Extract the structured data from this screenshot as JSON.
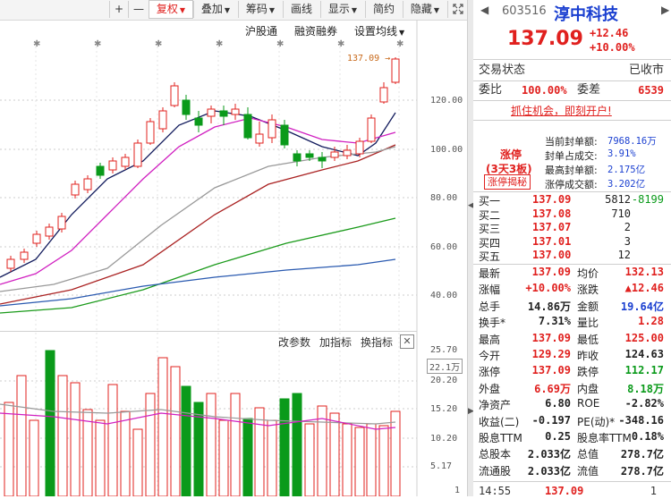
{
  "toolbar": {
    "plus": "+",
    "minus": "—",
    "fuquan": "复权",
    "diejia": "叠加",
    "choumai": "筹码",
    "huaxian": "画线",
    "xianshi": "显示",
    "jianyue": "简约",
    "yincang": "隐藏",
    "icon": "expand-icon"
  },
  "subbar": {
    "hugutong": "沪股通",
    "rongzi": "融资融券",
    "shezhi": "设置均线"
  },
  "price_axis": {
    "ticks": [
      "120.00",
      "100.00",
      "80.00",
      "60.00",
      "40.00"
    ],
    "last_label": "137.09"
  },
  "volume_panel": {
    "buttons": [
      "改参数",
      "加指标",
      "换指标"
    ],
    "ticks": [
      "25.70",
      "22.1万",
      "20.20",
      "15.20",
      "10.20",
      "5.17",
      "1"
    ]
  },
  "quote": {
    "code": "603516",
    "name": "淳中科技",
    "price": "137.09",
    "change": "+12.46",
    "change_pct": "+10.00%",
    "status_label": "交易状态",
    "status_value": "已收市",
    "weibi_label": "委比",
    "weibi_value": "100.00%",
    "weicha_label": "委差",
    "weicha_value": "6539",
    "ad": "抓住机会，即刻开户!"
  },
  "limit": {
    "tag": "涨停",
    "days": "(3天3板)",
    "button": "涨停揭秘",
    "rows": [
      {
        "label": "当前封单额:",
        "value": "7968.16万"
      },
      {
        "label": "封单占成交:",
        "value": "3.91%"
      },
      {
        "label": "最高封单额:",
        "value": "2.175亿"
      },
      {
        "label": "涨停成交额:",
        "value": "3.202亿"
      }
    ]
  },
  "orderbook": [
    {
      "label": "买一",
      "price": "137.09",
      "vol": "5812",
      "chg": "-8199"
    },
    {
      "label": "买二",
      "price": "137.08",
      "vol": "710",
      "chg": ""
    },
    {
      "label": "买三",
      "price": "137.07",
      "vol": "2",
      "chg": ""
    },
    {
      "label": "买四",
      "price": "137.01",
      "vol": "3",
      "chg": ""
    },
    {
      "label": "买五",
      "price": "137.00",
      "vol": "12",
      "chg": ""
    }
  ],
  "stats": [
    {
      "l1": "最新",
      "v1": "137.09",
      "c1": "red",
      "l2": "均价",
      "v2": "132.13",
      "c2": "red"
    },
    {
      "l1": "涨幅",
      "v1": "+10.00%",
      "c1": "red",
      "l2": "涨跌",
      "v2": "▲12.46",
      "c2": "red"
    },
    {
      "l1": "总手",
      "v1": "14.86万",
      "c1": "dark",
      "l2": "金额",
      "v2": "19.64亿",
      "c2": "blue"
    },
    {
      "l1": "换手*",
      "v1": "7.31%",
      "c1": "dark",
      "l2": "量比",
      "v2": "1.28",
      "c2": "red"
    },
    {
      "l1": "最高",
      "v1": "137.09",
      "c1": "red",
      "l2": "最低",
      "v2": "125.00",
      "c2": "red"
    },
    {
      "l1": "今开",
      "v1": "129.29",
      "c1": "red",
      "l2": "昨收",
      "v2": "124.63",
      "c2": "dark"
    },
    {
      "l1": "涨停",
      "v1": "137.09",
      "c1": "red",
      "l2": "跌停",
      "v2": "112.17",
      "c2": "green"
    },
    {
      "l1": "外盘",
      "v1": "6.69万",
      "c1": "red",
      "l2": "内盘",
      "v2": "8.18万",
      "c2": "green"
    },
    {
      "l1": "净资产",
      "v1": "6.80",
      "c1": "dark",
      "l2": "ROE",
      "v2": "-2.82%",
      "c2": "dark"
    },
    {
      "l1": "收益(二)",
      "v1": "-0.197",
      "c1": "dark",
      "l2": "PE(动)*",
      "v2": "-348.16",
      "c2": "dark"
    },
    {
      "l1": "股息TTM",
      "v1": "0.25",
      "c1": "dark",
      "l2": "股息率TTM",
      "v2": "0.18%",
      "c2": "dark"
    },
    {
      "l1": "总股本",
      "v1": "2.033亿",
      "c1": "dark",
      "l2": "总值",
      "v2": "278.7亿",
      "c2": "dark"
    },
    {
      "l1": "流通股",
      "v1": "2.033亿",
      "c1": "dark",
      "l2": "流值",
      "v2": "278.7亿",
      "c2": "dark"
    }
  ],
  "tick": {
    "time": "14:55",
    "price": "137.09",
    "vol": "1"
  },
  "colors": {
    "up": "#e0201e",
    "down": "#0a9a1a",
    "blue": "#1a3fd0"
  }
}
